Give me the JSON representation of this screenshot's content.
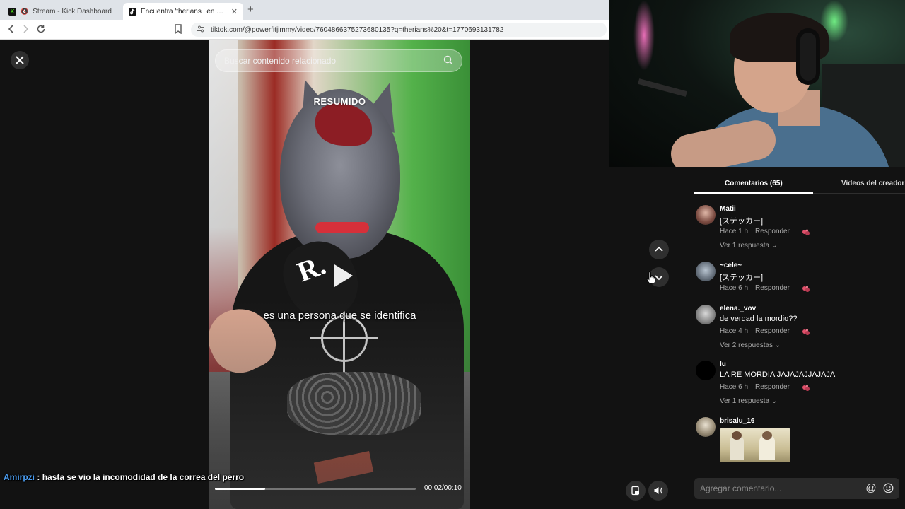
{
  "browser": {
    "tabs": [
      {
        "title": "Stream - Kick Dashboard",
        "favicon": "kick-icon",
        "muted": true
      },
      {
        "title": "Encuentra 'therians ' en TikTok | T",
        "favicon": "tiktok-icon",
        "active": true
      }
    ],
    "url": "tiktok.com/@powerfitjimmy/video/7604866375273680135?q=therians%20&t=1770693131782"
  },
  "video": {
    "search_placeholder": "Buscar contenido relacionado",
    "overlay_title": "RESUMIDO",
    "caption": "es una persona que se identifica",
    "time": "00:02/00:10",
    "progress": 0.25
  },
  "stream_chat": {
    "user": "Amirpzi",
    "message": ": hasta se vio la incomodidad de la correa del perro"
  },
  "comments_panel": {
    "tab_comments": "Comentarios (65)",
    "tab_creator_videos": "Videos del creador",
    "reply_label": "Responder",
    "comments": [
      {
        "user": "Matii",
        "text": "[ステッカー]",
        "time": "Hace 1 h",
        "replies": "Ver 1 respuesta"
      },
      {
        "user": "~cele~",
        "text": "[ステッカー]",
        "time": "Hace 6 h",
        "replies": ""
      },
      {
        "user": "elena._vov",
        "text": "de verdad la mordio??",
        "time": "Hace 4 h",
        "replies": "Ver 2 respuestas"
      },
      {
        "user": "lu",
        "text": "LA RE MORDIA JAJAJAJJAJAJA",
        "time": "Hace 6 h",
        "replies": "Ver 1 respuesta"
      },
      {
        "user": "brisalu_16",
        "text": "",
        "time": "",
        "replies": ""
      }
    ],
    "add_comment_placeholder": "Agregar comentario..."
  },
  "colors": {
    "background": "#121212",
    "chat_user": "#4a9cf0",
    "like_icon": "#e0506a"
  }
}
